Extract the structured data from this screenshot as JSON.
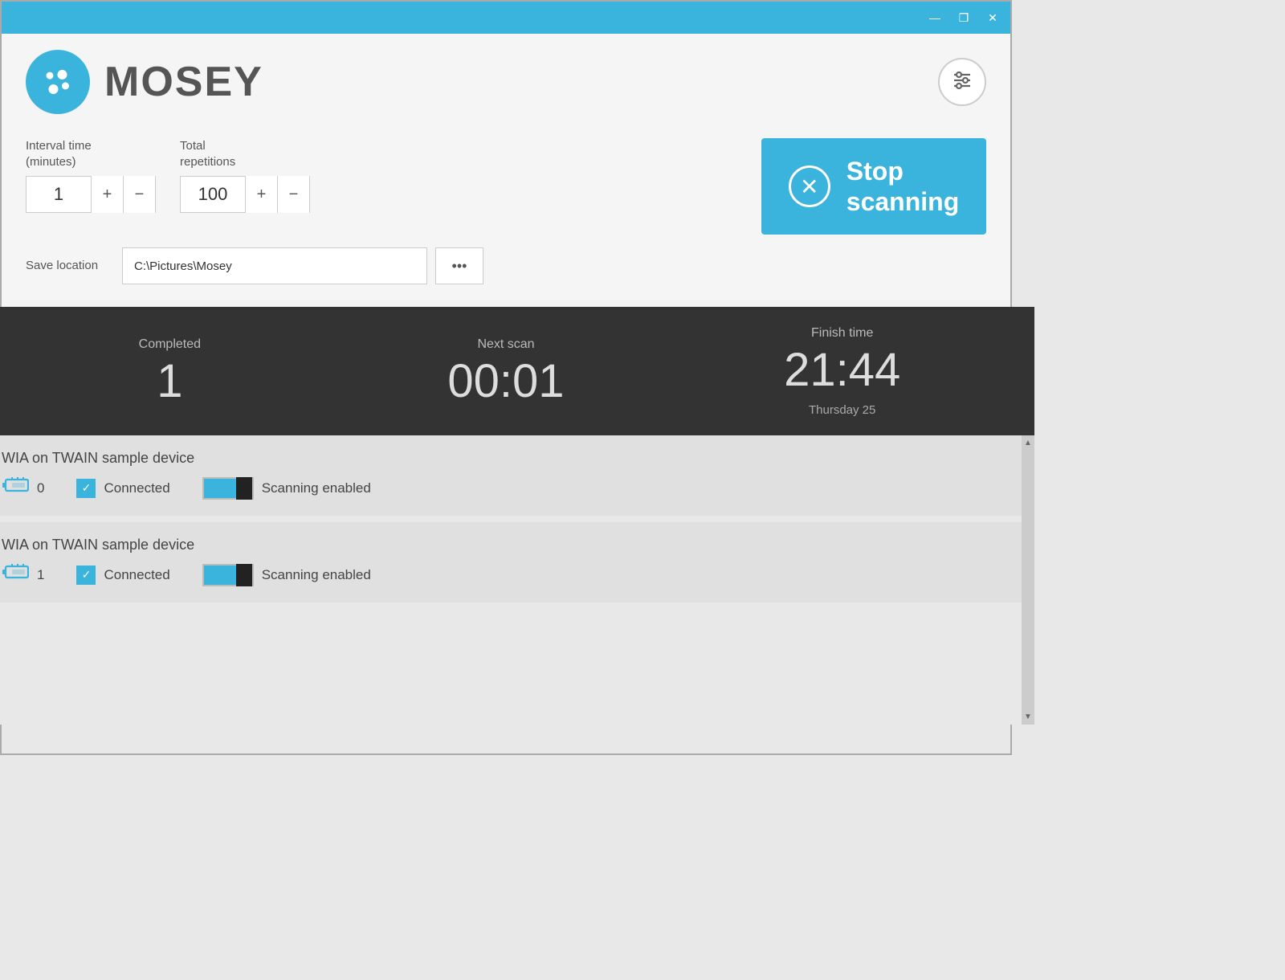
{
  "titlebar": {
    "minimize": "—",
    "maximize": "❐",
    "close": "✕"
  },
  "header": {
    "app_name": "MOSEY",
    "settings_label": "settings"
  },
  "controls": {
    "interval_label": "Interval time\n(minutes)",
    "interval_value": "1",
    "interval_plus": "+",
    "interval_minus": "−",
    "repetitions_label": "Total\nrepetitions",
    "repetitions_value": "100",
    "repetitions_plus": "+",
    "repetitions_minus": "−",
    "save_location_label": "Save location",
    "save_location_value": "C:\\Pictures\\Mosey",
    "browse_label": "•••",
    "stop_button_label": "Stop\nscanning"
  },
  "stats": {
    "completed_label": "Completed",
    "completed_value": "1",
    "next_scan_label": "Next scan",
    "next_scan_value": "00:01",
    "finish_time_label": "Finish time",
    "finish_time_value": "21:44",
    "finish_date": "Thursday 25"
  },
  "devices": [
    {
      "name": "WIA on TWAIN sample device",
      "scan_count": "0",
      "connected_text": "Connected",
      "scanning_label": "Scanning enabled"
    },
    {
      "name": "WIA on TWAIN sample device",
      "scan_count": "1",
      "connected_text": "Connected",
      "scanning_label": "Scanning enabled"
    }
  ]
}
